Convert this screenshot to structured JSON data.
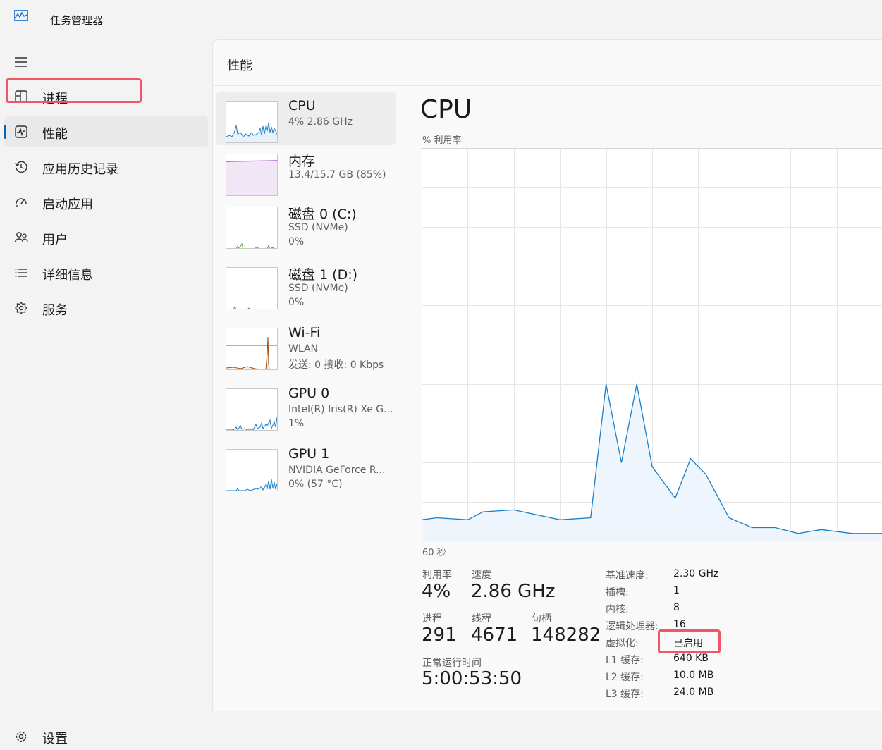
{
  "app": {
    "title": "任务管理器"
  },
  "nav": {
    "items": [
      {
        "label": "进程",
        "icon": "processes-icon"
      },
      {
        "label": "性能",
        "icon": "performance-icon",
        "active": true
      },
      {
        "label": "应用历史记录",
        "icon": "history-icon"
      },
      {
        "label": "启动应用",
        "icon": "startup-icon"
      },
      {
        "label": "用户",
        "icon": "users-icon"
      },
      {
        "label": "详细信息",
        "icon": "details-icon"
      },
      {
        "label": "服务",
        "icon": "services-icon"
      }
    ],
    "settings_label": "设置"
  },
  "page": {
    "title": "性能"
  },
  "devices": [
    {
      "name": "CPU",
      "sub1": "4%  2.86 GHz",
      "sub2": "",
      "color": "#1a7fc8"
    },
    {
      "name": "内存",
      "sub1": "13.4/15.7 GB (85%)",
      "sub2": "",
      "color": "#8b2cb0"
    },
    {
      "name": "磁盘 0 (C:)",
      "sub1": "SSD (NVMe)",
      "sub2": "0%",
      "color": "#4ca62a"
    },
    {
      "name": "磁盘 1 (D:)",
      "sub1": "SSD (NVMe)",
      "sub2": "0%",
      "color": "#4ca62a"
    },
    {
      "name": "Wi-Fi",
      "sub1": "WLAN",
      "sub2": "发送: 0 接收: 0 Kbps",
      "color": "#a64d0f"
    },
    {
      "name": "GPU 0",
      "sub1": "Intel(R) Iris(R) Xe G...",
      "sub2": "1%",
      "color": "#1a7fc8"
    },
    {
      "name": "GPU 1",
      "sub1": "NVIDIA GeForce R...",
      "sub2": "0% (57 °C)",
      "color": "#1a7fc8"
    }
  ],
  "detail": {
    "title": "CPU",
    "graph_label": "% 利用率",
    "time_label": "60 秒",
    "stats": {
      "utilization": {
        "label": "利用率",
        "value": "4%"
      },
      "speed": {
        "label": "速度",
        "value": "2.86 GHz"
      },
      "processes": {
        "label": "进程",
        "value": "291"
      },
      "threads": {
        "label": "线程",
        "value": "4671"
      },
      "handles": {
        "label": "句柄",
        "value": "148282"
      },
      "uptime": {
        "label": "正常运行时间",
        "value": "5:00:53:50"
      }
    },
    "specs": [
      {
        "key": "基准速度:",
        "value": "2.30 GHz"
      },
      {
        "key": "插槽:",
        "value": "1"
      },
      {
        "key": "内核:",
        "value": "8"
      },
      {
        "key": "逻辑处理器:",
        "value": "16"
      },
      {
        "key": "虚拟化:",
        "value": "已启用"
      },
      {
        "key": "L1 缓存:",
        "value": "640 KB"
      },
      {
        "key": "L2 缓存:",
        "value": "10.0 MB"
      },
      {
        "key": "L3 缓存:",
        "value": "24.0 MB"
      }
    ]
  },
  "chart_data": {
    "type": "area",
    "ylim": [
      0,
      100
    ],
    "xlim": [
      0,
      60
    ],
    "grid": true,
    "color": "#1a7fc8",
    "x": [
      0,
      2,
      6,
      8,
      12,
      18,
      22,
      24,
      26,
      28,
      30,
      33,
      35,
      37,
      40,
      43,
      46,
      49,
      52,
      56,
      60
    ],
    "values": [
      5.5,
      6,
      5.5,
      7.5,
      8,
      5.5,
      6,
      40,
      20,
      40,
      19,
      11,
      21,
      17,
      6,
      3.5,
      3.5,
      2,
      3,
      2,
      2
    ]
  }
}
